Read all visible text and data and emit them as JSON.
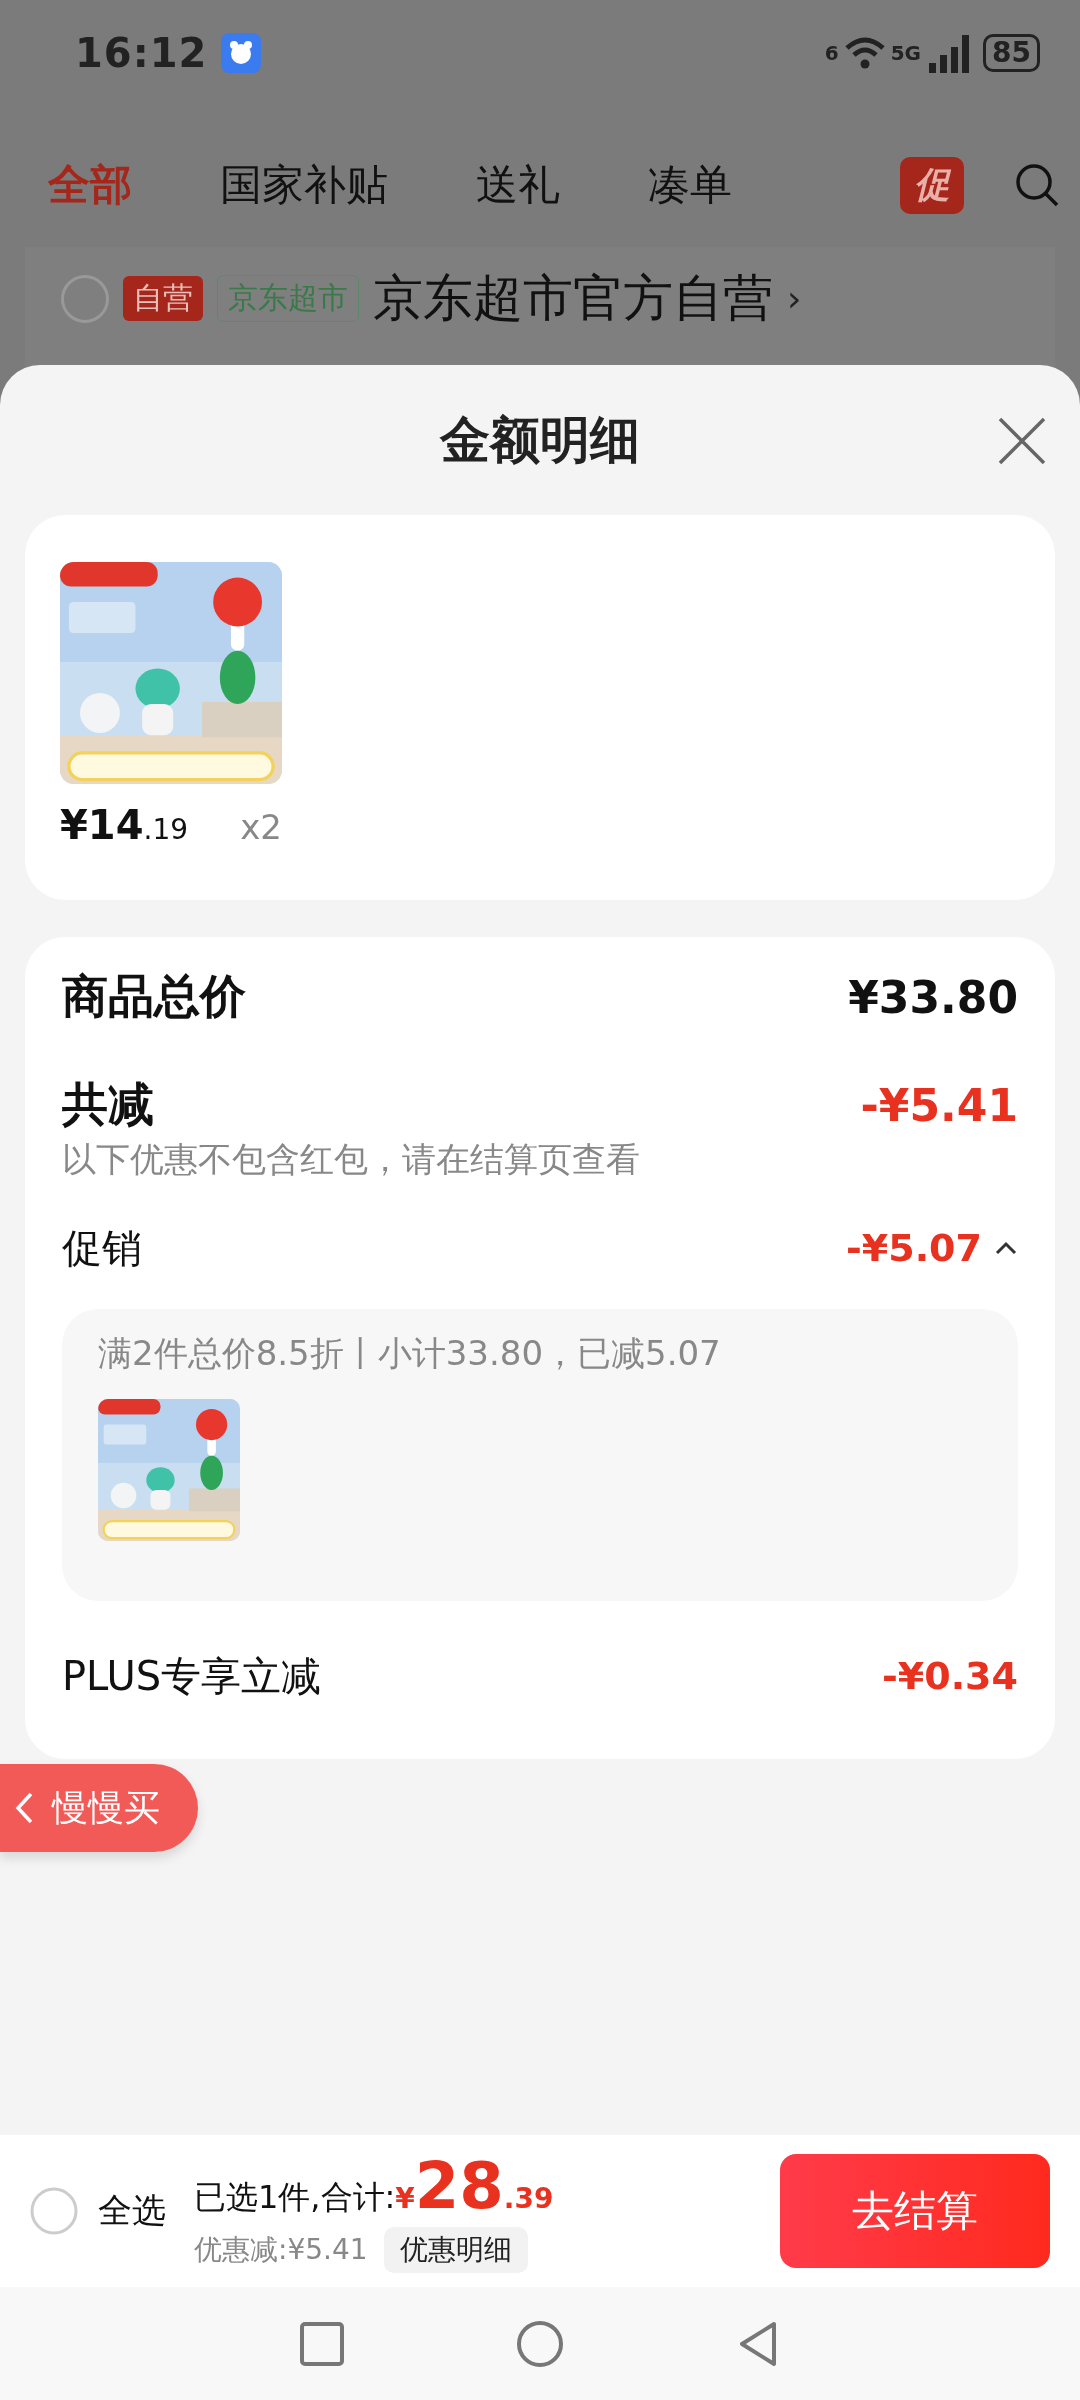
{
  "status_bar": {
    "time": "16:12",
    "wifi_label": "6",
    "network": "5G",
    "battery": "85"
  },
  "background_page": {
    "tabs": [
      {
        "label": "全部",
        "selected": true
      },
      {
        "label": "国家补贴",
        "selected": false
      },
      {
        "label": "送礼",
        "selected": false
      },
      {
        "label": "凑单",
        "selected": false
      }
    ],
    "promo_badge": "促",
    "store": {
      "checked": false,
      "badges": [
        {
          "text": "自营",
          "kind": "self"
        },
        {
          "text": "京东超市",
          "kind": "market"
        }
      ],
      "name": "京东超市官方自营",
      "chevron": "›"
    }
  },
  "sheet": {
    "title": "金额明细",
    "product": {
      "kind": "picture",
      "price_symbol": "¥",
      "price_main": "14",
      "price_cents": ".19",
      "quantity": "x2"
    },
    "summary": {
      "total": {
        "label": "商品总价",
        "value": "¥33.80"
      },
      "discount": {
        "label": "共减",
        "value": "-¥5.41",
        "note": "以下优惠不包含红包，请在结算页查看"
      },
      "promotion": {
        "label": "促销",
        "value": "-¥5.07",
        "expanded": true,
        "detail": "满2件总价8.5折丨小计33.80，已减5.07"
      },
      "plus": {
        "label": "PLUS专享立减",
        "value": "-¥0.34"
      }
    },
    "floating_button": "慢慢买"
  },
  "bottom_bar": {
    "select_all": {
      "label": "全选",
      "checked": false
    },
    "summary": "已选1件,合计:",
    "total_symbol": "¥",
    "total_main": "28",
    "total_cents": ".39",
    "savings": "优惠减:¥5.41",
    "details_button": "优惠明细",
    "checkout": "去结算"
  }
}
